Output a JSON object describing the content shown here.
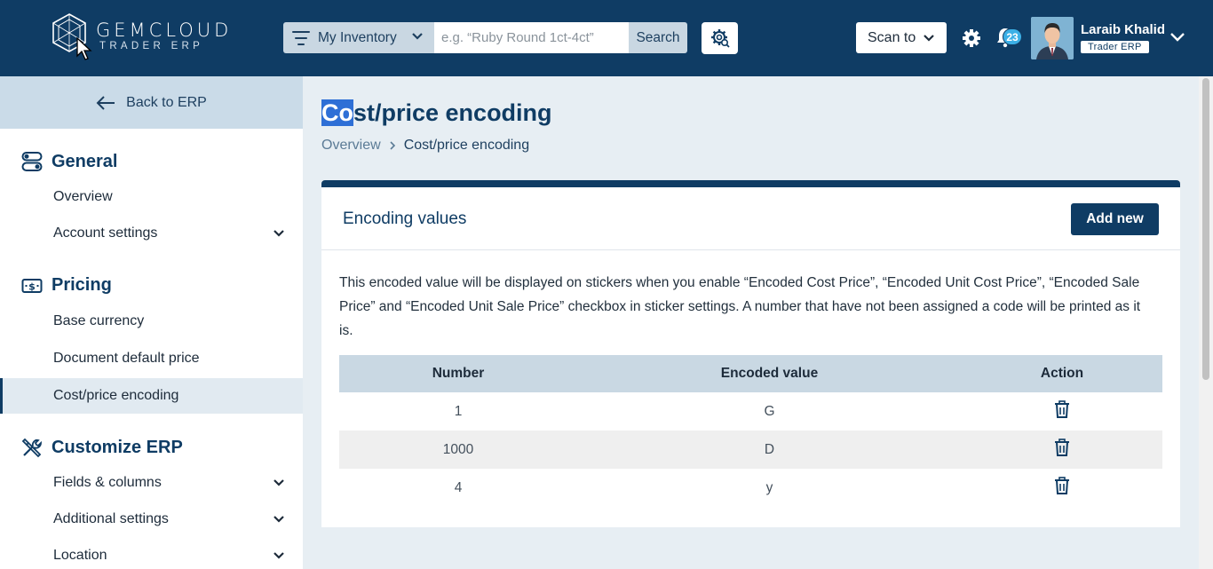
{
  "brand": {
    "name": "GEMCLOUD",
    "tagline": "TRADER ERP"
  },
  "topbar": {
    "inventory_select": "My Inventory",
    "search_placeholder": "e.g. “Ruby Round 1ct-4ct”",
    "search_label": "Search",
    "scan_label": "Scan to",
    "notification_count": "23",
    "user_name": "Laraib Khalid",
    "user_role": "Trader ERP"
  },
  "sidebar": {
    "back_label": "Back to ERP",
    "sections": [
      {
        "title": "General",
        "icon": "toggle-icon",
        "items": [
          "Overview",
          "Account settings"
        ]
      },
      {
        "title": "Pricing",
        "icon": "dollar-bill-icon",
        "items": [
          "Base currency",
          "Document default price",
          "Cost/price encoding"
        ]
      },
      {
        "title": "Customize ERP",
        "icon": "tools-icon",
        "items": [
          "Fields & columns",
          "Additional settings",
          "Location"
        ]
      }
    ],
    "active_item": "Cost/price encoding"
  },
  "page": {
    "title_highlight": "Co",
    "title_rest": "st/price encoding",
    "breadcrumb": [
      "Overview",
      "Cost/price encoding"
    ]
  },
  "card": {
    "title": "Encoding values",
    "add_label": "Add new",
    "description": "This encoded value will be displayed on stickers when you enable “Encoded Cost Price”, “Encoded Unit Cost Price”, “Encoded Sale Price” and “Encoded Unit Sale Price” checkbox in sticker settings. A number that have not been assigned a code will be printed as it is.",
    "columns": [
      "Number",
      "Encoded value",
      "Action"
    ],
    "rows": [
      {
        "number": "1",
        "encoded": "G"
      },
      {
        "number": "1000",
        "encoded": "D"
      },
      {
        "number": "4",
        "encoded": "y"
      }
    ]
  },
  "colors": {
    "primary": "#0f3c64",
    "accent": "#3cb0e6",
    "highlight": "#2e6fd6"
  }
}
